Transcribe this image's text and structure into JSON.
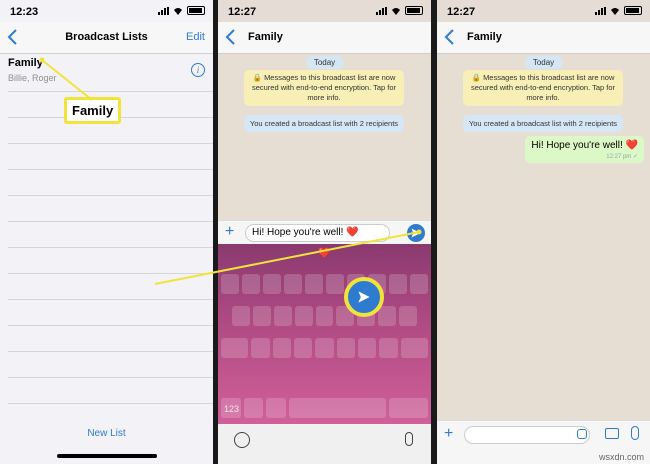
{
  "colors": {
    "accent": "#2f7bd0",
    "callout": "#f2e33b",
    "bubble_sent": "#dcf8c6",
    "system_yellow": "#f7efb6",
    "system_blue": "#d5e7f5"
  },
  "panel1": {
    "status_time": "12:23",
    "nav_title": "Broadcast Lists",
    "edit_label": "Edit",
    "list": {
      "name": "Family",
      "members": "Billie, Roger"
    },
    "new_list_label": "New List",
    "callout_label": "Family"
  },
  "panel2": {
    "status_time": "12:27",
    "chat_title": "Family",
    "today_label": "Today",
    "encryption_notice": "Messages to this broadcast list are now secured with end-to-end encryption. Tap for more info.",
    "created_notice": "You created a broadcast list with 2 recipients",
    "input_value": "Hi! Hope you're well! ❤️",
    "keyboard_suggestion": "❤️",
    "key_123": "123"
  },
  "panel3": {
    "status_time": "12:27",
    "chat_title": "Family",
    "today_label": "Today",
    "encryption_notice": "Messages to this broadcast list are now secured with end-to-end encryption. Tap for more info.",
    "created_notice": "You created a broadcast list with 2 recipients",
    "sent_message": "Hi! Hope you're well! ❤️",
    "sent_time": "12:27 pm"
  },
  "watermark": "wsxdn.com"
}
